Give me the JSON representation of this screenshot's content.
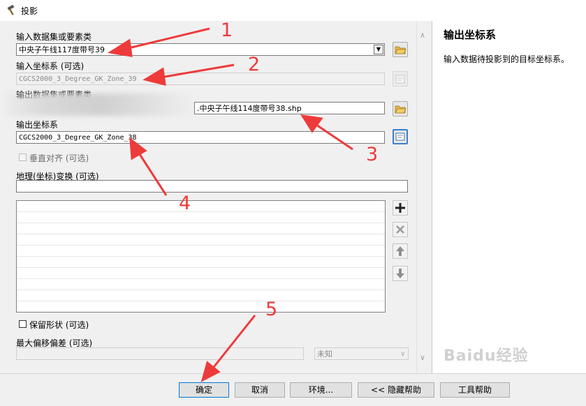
{
  "window": {
    "title": "投影",
    "icon": "hammer-icon"
  },
  "form": {
    "input_dataset": {
      "label": "输入数据集或要素类",
      "value": "中央子午线117度带号39"
    },
    "input_crs": {
      "label": "输入坐标系 (可选)",
      "value": "CGCS2000_3_Degree_GK_Zone_39"
    },
    "output_dataset": {
      "label": "输出数据集或要素类",
      "value": ".中央子午线114度带号38.shp"
    },
    "output_crs": {
      "label": "输出坐标系",
      "value": "CGCS2000_3_Degree_GK_Zone_38"
    },
    "vertical": {
      "label": "垂直对齐 (可选)"
    },
    "geo_transform": {
      "label": "地理(坐标)变换 (可选)",
      "value": ""
    },
    "preserve_shape": {
      "label": "保留形状 (可选)"
    },
    "max_offset": {
      "label": "最大偏移偏差 (可选)",
      "value": "",
      "unit": "未知"
    }
  },
  "help": {
    "title": "输出坐标系",
    "description": "输入数据待投影到的目标坐标系。"
  },
  "buttons": {
    "ok": "确定",
    "cancel": "取消",
    "environments": "环境...",
    "hide_help": "<< 隐藏帮助",
    "tool_help": "工具帮助"
  },
  "annotations": [
    "1",
    "2",
    "3",
    "4",
    "5"
  ],
  "watermark": "Baidu经验",
  "colors": {
    "annotation": "#ee3a3a",
    "active_border": "#3a7fd0"
  }
}
